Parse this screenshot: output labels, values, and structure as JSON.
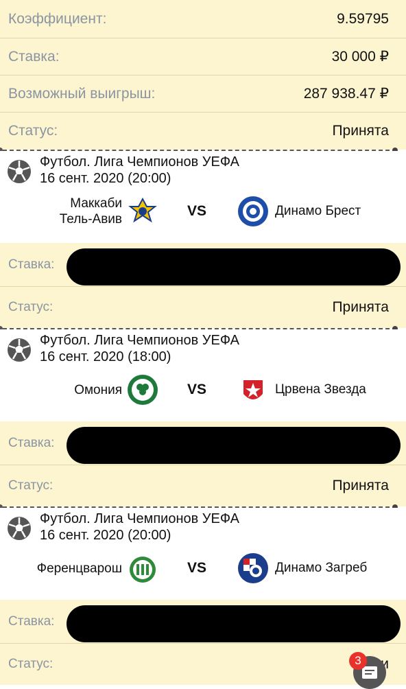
{
  "summary": {
    "coefficient_label": "Коэффициент:",
    "coefficient_value": "9.59795",
    "stake_label": "Ставка:",
    "stake_value": "30 000 ₽",
    "win_label": "Возможный выигрыш:",
    "win_value": "287 938.47 ₽",
    "status_label": "Статус:",
    "status_value": "Принята"
  },
  "events": [
    {
      "league": "Футбол. Лига Чемпионов УЕФА",
      "date": "16 сент. 2020 (20:00)",
      "home_line1": "Маккаби",
      "home_line2": "Тель-Авив",
      "vs": "VS",
      "away": "Динамо Брест",
      "stake_label": "Ставка:",
      "status_label": "Статус:",
      "status_value": "Принята"
    },
    {
      "league": "Футбол. Лига Чемпионов УЕФА",
      "date": "16 сент. 2020 (18:00)",
      "home_line1": "Омония",
      "vs": "VS",
      "away": "Црвена Звезда",
      "stake_label": "Ставка:",
      "status_label": "Статус:",
      "status_value": "Принята"
    },
    {
      "league": "Футбол. Лига Чемпионов УЕФА",
      "date": "16 сент. 2020 (20:00)",
      "home_line1": "Ференцварош",
      "vs": "VS",
      "away": "Динамо Загреб",
      "stake_label": "Ставка:",
      "status_label": "Статус:",
      "status_value": "При"
    }
  ],
  "fab": {
    "badge": "3",
    "icon": "betslip-icon"
  },
  "colors": {
    "row_bg": "#fdf4d0",
    "label": "#8b95a2",
    "badge": "#e8322a"
  }
}
